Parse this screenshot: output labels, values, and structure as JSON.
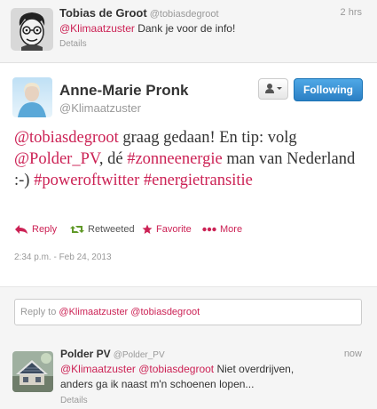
{
  "colors": {
    "link": "#cc2255",
    "follow_button": "#2b7fc4",
    "muted": "#999999"
  },
  "top_tweet": {
    "name": "Tobias de Groot",
    "handle": "@tobiasdegroot",
    "time": "2 hrs",
    "mention": "@Klimaatzuster",
    "text": "Dank je voor de info!",
    "details": "Details",
    "avatar_icon": "cartoon-avatar-icon"
  },
  "main_tweet": {
    "name": "Anne-Marie Pronk",
    "handle": "@Klimaatzuster",
    "user_menu_icon": "user-dropdown-icon",
    "follow_label": "Following",
    "text": {
      "m1": "@tobiasdegroot",
      "t1": " graag gedaan! En tip: volg ",
      "m2": "@Polder_PV",
      "t2": ", dé ",
      "h1": "#zonneenergie",
      "t3": " man van Nederland :-) ",
      "h2": "#poweroftwitter",
      "t4": " ",
      "h3": "#energietransitie"
    },
    "actions": {
      "reply": "Reply",
      "retweeted": "Retweeted",
      "favorite": "Favorite",
      "more": "More"
    },
    "timestamp": "2:34 p.m. - Feb 24, 2013"
  },
  "reply_box": {
    "prefix": "Reply to ",
    "mention1": "@Klimaatzuster",
    "mention2": "@tobiasdegroot"
  },
  "bottom_tweet": {
    "name": "Polder PV",
    "handle": "@Polder_PV",
    "time": "now",
    "mention1": "@Klimaatzuster",
    "mention2": "@tobiasdegroot",
    "text": "Niet overdrijven, anders ga ik naast m'n schoenen lopen...",
    "details": "Details"
  }
}
